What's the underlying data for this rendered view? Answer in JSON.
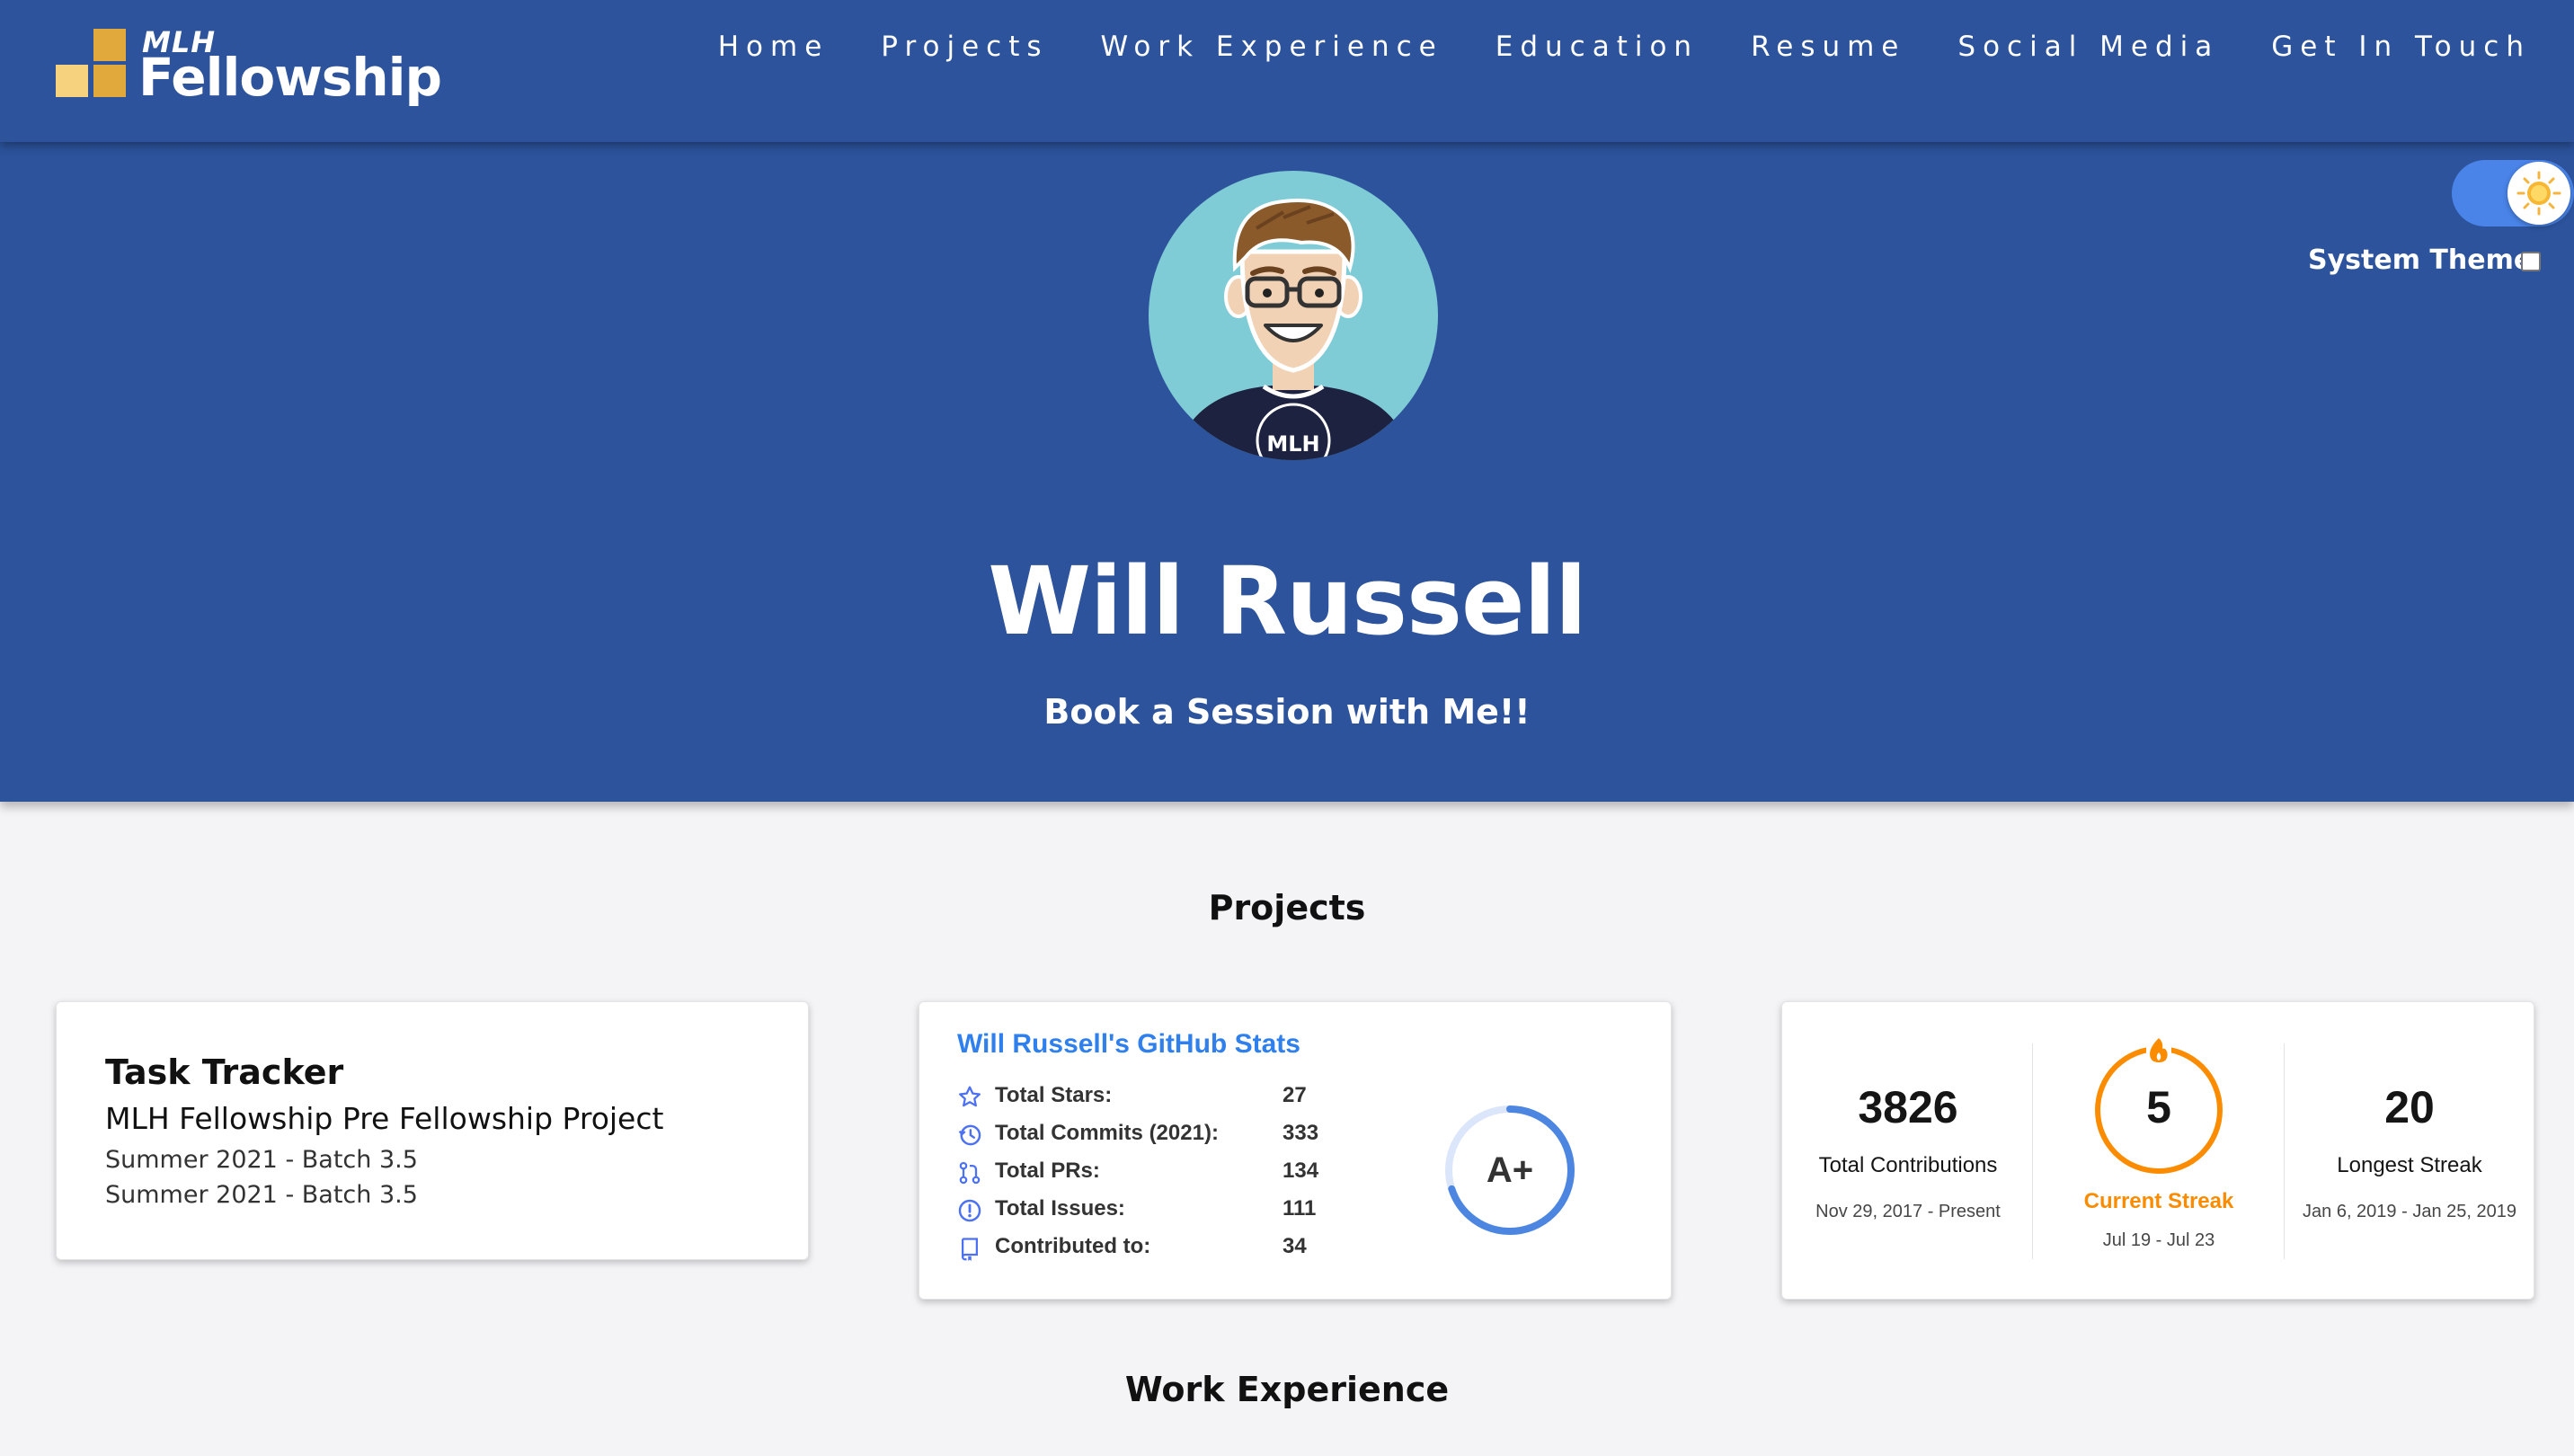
{
  "brand": {
    "small": "MLH",
    "big": "Fellowship"
  },
  "nav": [
    "Home",
    "Projects",
    "Work Experience",
    "Education",
    "Resume",
    "Social Media",
    "Get In Touch"
  ],
  "hero": {
    "name": "Will Russell",
    "cta": "Book a Session with Me!!",
    "avatar_shirt_text": "MLH"
  },
  "theme": {
    "system_label": "System Theme",
    "toggle_on": true,
    "system_checked": false
  },
  "sections": {
    "projects": "Projects",
    "work": "Work Experience"
  },
  "task_card": {
    "title": "Task Tracker",
    "description": "MLH Fellowship Pre Fellowship Project",
    "meta": [
      "Summer 2021 - Batch 3.5",
      "Summer 2021 - Batch 3.5"
    ]
  },
  "github_stats": {
    "title": "Will Russell's GitHub Stats",
    "rows": [
      {
        "icon": "star-icon",
        "label": "Total Stars:",
        "value": "27"
      },
      {
        "icon": "history-icon",
        "label": "Total Commits (2021):",
        "value": "333"
      },
      {
        "icon": "pull-request-icon",
        "label": "Total PRs:",
        "value": "134"
      },
      {
        "icon": "issue-icon",
        "label": "Total Issues:",
        "value": "111"
      },
      {
        "icon": "repo-icon",
        "label": "Contributed to:",
        "value": "34"
      }
    ],
    "rank": "A+",
    "rank_progress": 0.7
  },
  "streak": {
    "total": {
      "value": "3826",
      "label": "Total Contributions",
      "range": "Nov 29, 2017 - Present"
    },
    "current": {
      "value": "5",
      "label": "Current Streak",
      "range": "Jul 19 - Jul 23"
    },
    "longest": {
      "value": "20",
      "label": "Longest Streak",
      "range": "Jan 6, 2019 - Jan 25, 2019"
    }
  },
  "colors": {
    "primary": "#2c539b",
    "accent_blue": "#2f80ed",
    "streak_orange": "#fb8c00",
    "logo_gold": "#e1a93b",
    "logo_light": "#f6d27f",
    "background": "#f4f4f7"
  }
}
